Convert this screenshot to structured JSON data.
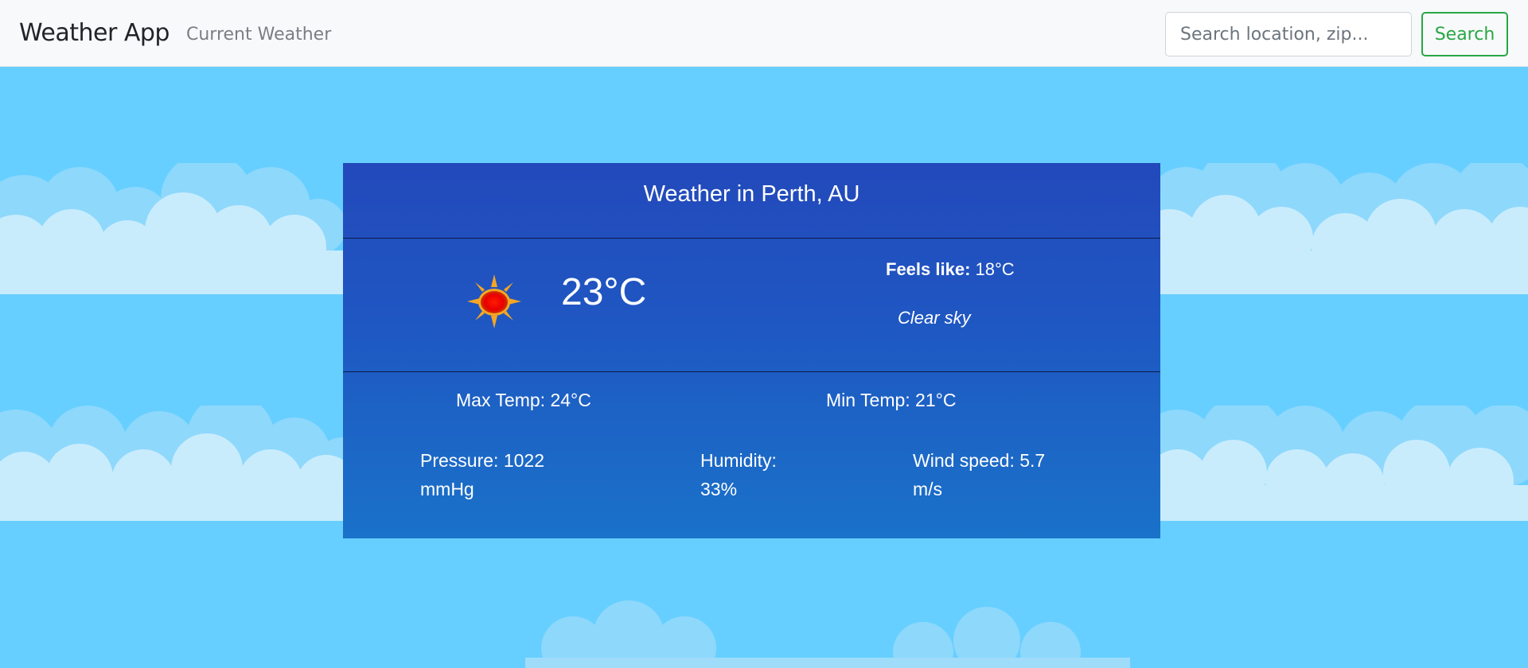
{
  "navbar": {
    "brand": "Weather App",
    "nav_link": "Current Weather",
    "search_placeholder": "Search location, zip...",
    "search_button": "Search"
  },
  "weather": {
    "title": "Weather in Perth, AU",
    "temperature": "23°C",
    "feels_like_label": "Feels like:",
    "feels_like_value": "18°C",
    "description": "Clear sky",
    "icon": "sun-icon",
    "max_temp": "Max Temp: 24°C",
    "min_temp": "Min Temp: 21°C",
    "pressure_line1": "Pressure: 1022",
    "pressure_line2": "mmHg",
    "humidity_line1": "Humidity:",
    "humidity_line2": "33%",
    "wind_line1": "Wind speed: 5.7",
    "wind_line2": "m/s"
  },
  "colors": {
    "sky": "#66cfff",
    "card_top": "#2349bb",
    "card_bottom": "#1a72c9",
    "search_button": "#28a745"
  }
}
